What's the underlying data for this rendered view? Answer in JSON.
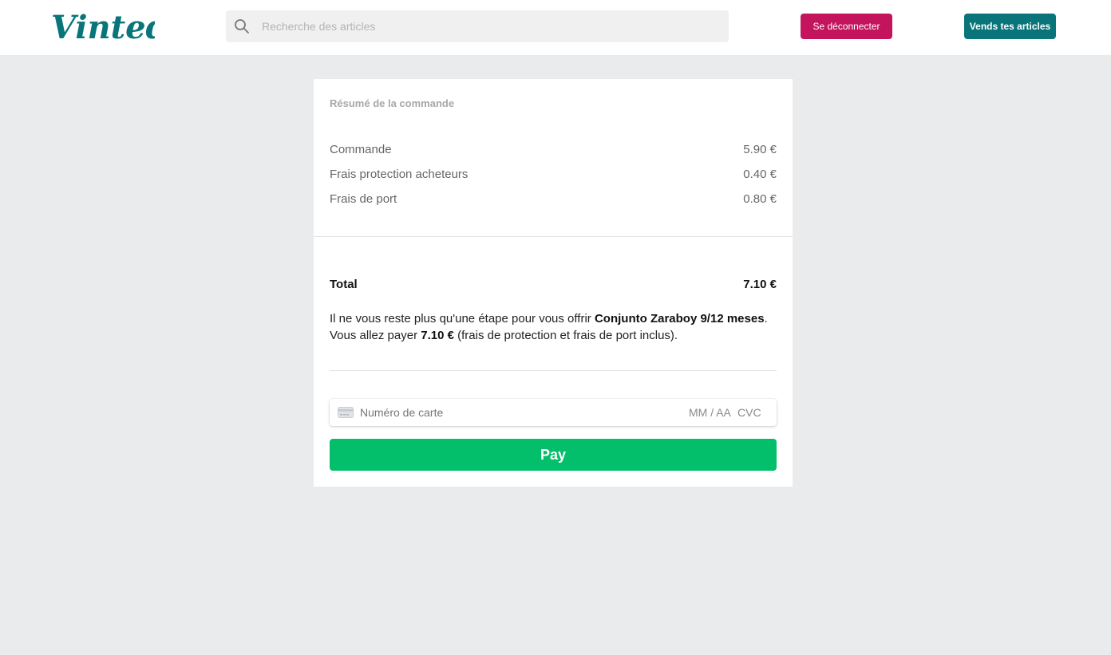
{
  "header": {
    "logo_text": "Vinted",
    "search_placeholder": "Recherche des articles",
    "logout_label": "Se déconnecter",
    "sell_label": "Vends tes articles"
  },
  "order": {
    "summary_title": "Résumé de la commande",
    "lines": [
      {
        "label": "Commande",
        "amount": "5.90 €"
      },
      {
        "label": "Frais protection acheteurs",
        "amount": "0.40 €"
      },
      {
        "label": "Frais de port",
        "amount": "0.80 €"
      }
    ],
    "total_label": "Total",
    "total_amount": "7.10 €",
    "message": {
      "part1": "Il ne vous reste plus qu'une étape pour vous offrir ",
      "item_name": "Conjunto Zaraboy 9/12 meses",
      "part2": ". Vous allez payer ",
      "amount": "7.10 €",
      "part3": " (frais de protection et frais de port inclus)."
    }
  },
  "payment": {
    "card_number_placeholder": "Numéro de carte",
    "expiry_placeholder": "MM / AA",
    "cvc_placeholder": "CVC",
    "pay_label": "Pay"
  },
  "colors": {
    "brand": "#09757a",
    "logout": "#c4145e",
    "pay": "#03bf6b",
    "background": "#eaebed"
  },
  "icons": [
    "search-icon",
    "credit-card-icon"
  ]
}
